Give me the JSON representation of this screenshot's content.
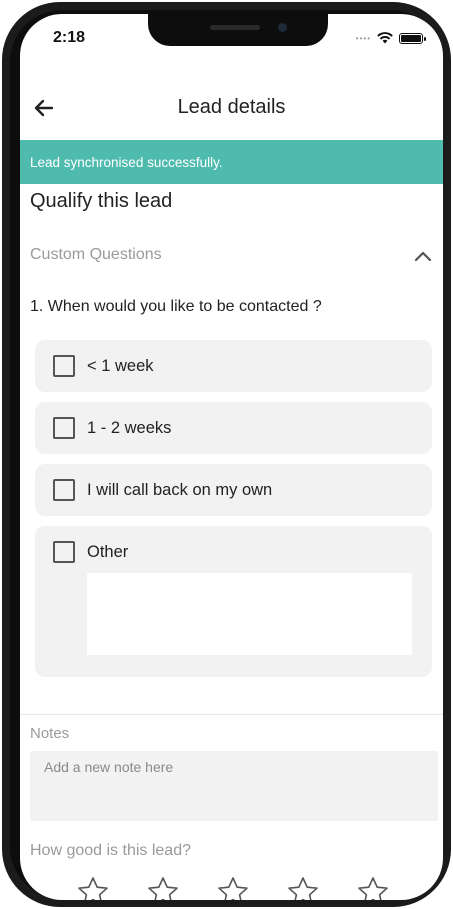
{
  "status_bar": {
    "time": "2:18",
    "signal": "••••",
    "wifi_icon": "wifi-icon",
    "battery_icon": "battery-icon"
  },
  "header": {
    "title": "Lead details",
    "back_icon": "arrow-left-icon"
  },
  "banner": {
    "message": "Lead synchronised successfully.",
    "color": "#4fbbae"
  },
  "qualify": {
    "title": "Qualify this lead",
    "custom_questions_label": "Custom Questions",
    "collapse_icon": "chevron-up-icon",
    "question": "1. When would you like to be contacted ?",
    "options": [
      {
        "label": "< 1 week",
        "checked": false
      },
      {
        "label": "1 - 2 weeks",
        "checked": false
      },
      {
        "label": "I will call back on my own",
        "checked": false
      },
      {
        "label": "Other",
        "checked": false
      }
    ],
    "other_value": ""
  },
  "notes": {
    "label": "Notes",
    "placeholder": "Add a new note here",
    "value": ""
  },
  "rating": {
    "label": "How good is this lead?",
    "max": 5,
    "value": 0,
    "star_icon": "star-outline-icon"
  }
}
